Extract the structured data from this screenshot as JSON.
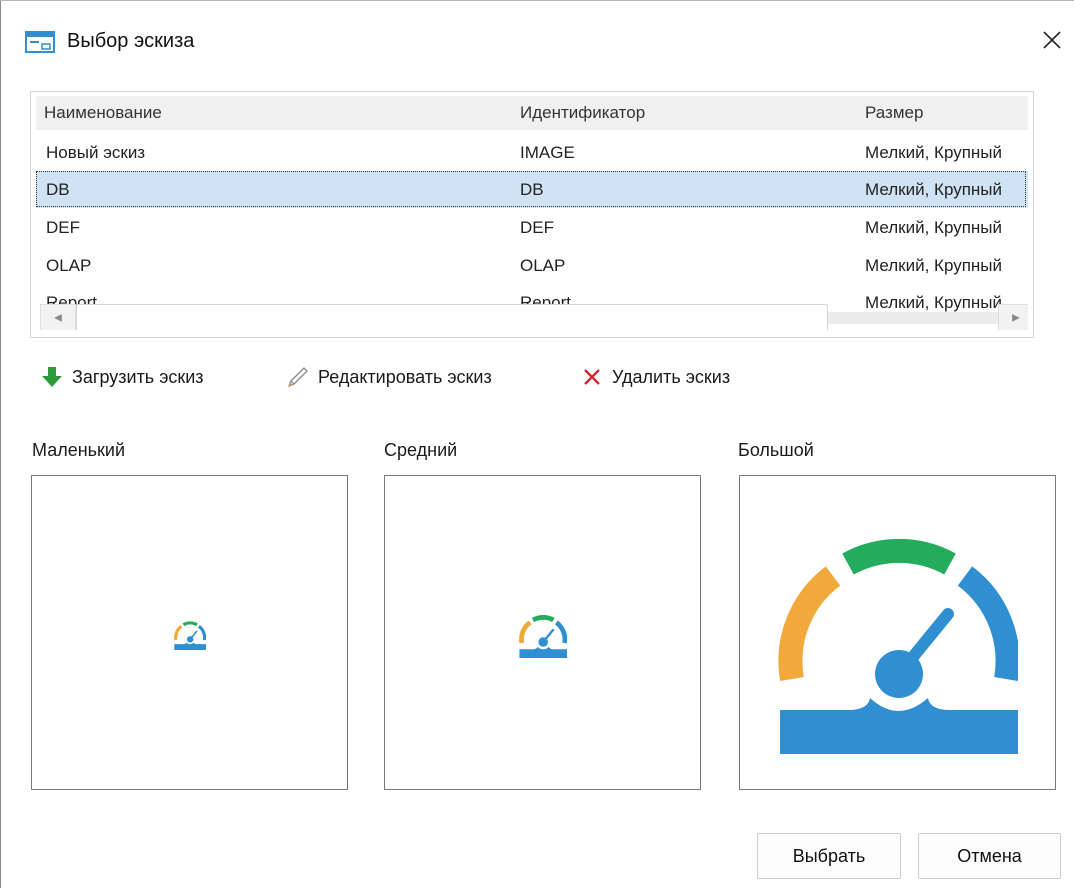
{
  "window": {
    "title": "Выбор эскиза"
  },
  "grid": {
    "columns": [
      "Наименование",
      "Идентификатор",
      "Размер"
    ],
    "rows": [
      {
        "name": "Новый эскиз",
        "id": "IMAGE",
        "size": "Мелкий, Крупный"
      },
      {
        "name": "DB",
        "id": "DB",
        "size": "Мелкий, Крупный",
        "selected": true
      },
      {
        "name": "DEF",
        "id": "DEF",
        "size": "Мелкий, Крупный"
      },
      {
        "name": "OLAP",
        "id": "OLAP",
        "size": "Мелкий, Крупный"
      },
      {
        "name": "Report",
        "id": "Report",
        "size": "Мелкий, Крупный"
      }
    ]
  },
  "toolbar": {
    "load_label": "Загрузить эскиз",
    "edit_label": "Редактировать эскиз",
    "delete_label": "Удалить эскиз"
  },
  "previews": {
    "small_label": "Маленький",
    "medium_label": "Средний",
    "large_label": "Большой"
  },
  "buttons": {
    "select_label": "Выбрать",
    "cancel_label": "Отмена"
  },
  "icons": {
    "app": "window-icon",
    "close": "close-icon",
    "load": "arrow-down-icon",
    "edit": "pencil-icon",
    "delete": "x-icon",
    "preview": "speedometer-icon"
  },
  "colors": {
    "selected_row": "#cfe3f4",
    "gauge_orange": "#f2a93b",
    "gauge_green": "#22ac5c",
    "gauge_blue": "#2f8fd0",
    "load_green": "#2d9a3e",
    "delete_red": "#d9232e"
  }
}
